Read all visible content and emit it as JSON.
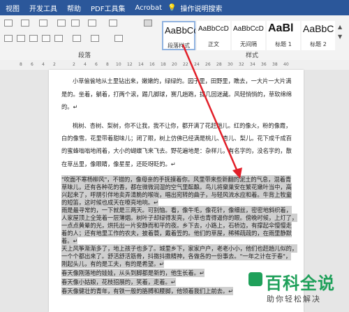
{
  "menu": {
    "items": [
      "视图",
      "开发工具",
      "帮助",
      "PDF工具集",
      "Acrobat"
    ],
    "tell_me": "操作说明搜索"
  },
  "ribbon": {
    "group_paragraph": "段落",
    "group_styles": "样式",
    "styles": [
      {
        "preview": "AaBbCcI",
        "name": "段落样式"
      },
      {
        "preview": "AaBbCcDc",
        "name": "正文"
      },
      {
        "preview": "AaBbCcDc",
        "name": "无间隔"
      },
      {
        "preview": "AaBl",
        "name": "标题 1"
      },
      {
        "preview": "AaBbC",
        "name": "标题 2"
      }
    ]
  },
  "ruler": {
    "ticks": [
      "8",
      "6",
      "4",
      "2",
      "2",
      "4",
      "6",
      "8",
      "10",
      "12",
      "14",
      "16",
      "18",
      "20",
      "22",
      "24",
      "26",
      "28",
      "30",
      "32",
      "34",
      "36",
      "38",
      "40"
    ]
  },
  "doc": {
    "lines": [
      "小草偷偷地从土里钻出来，嫩嫩的，绿绿的。园子里，田野里，瞧去，一大片一大片满",
      "是的。坐着，躺着，打两个滚，踢几脚球，赛几趟跑，捉几回迷藏。风轻悄悄的，草软绵绵",
      "的。↵",
      "桃树、杏树、梨树，你不让我，我不让你，都开满了花赶趟儿。红的像火，粉的像霞，",
      "白的像雪。花里带着甜味儿；闭了眼，树上仿佛已经满是桃儿、杏儿、梨儿。花下成千成百",
      "的蜜蜂嗡嗡地闹着，大小的蝴蝶飞来飞去。野花遍地是：杂样儿，有名字的，没名字的，散",
      "在草丛里，像眼睛，像星星，还眨呀眨的。↵",
      "\"吹面不寒杨柳风\"，不错的，像母亲的手抚摸着你。风里带来些新翻的泥土的气息，混着青",
      "草味儿，还有各种花的香，都在微微润湿的空气里酝酿。鸟儿将窠巢安在繁花嫩叶当中，高",
      "兴起来了，呼朋引伴地卖弄清脆的喉咙，唱出宛转的曲子，与轻风流水应和着。牛背上牧童",
      "的短笛，这时候也成天在嘹亮地响。↵",
      "雨是最寻常的，一下就是三两天。可别恼。看，像牛毛，像花针，像细丝，密密地斜织着，",
      "人家屋顶上全笼着一层薄烟。树叶子却绿得发亮，小草也青得逼你的眼。傍晚时候，上灯了，",
      "一点点黄晕的光，烘托出一片安静而和平的夜。乡下去，小路上，石桥边，有撑起伞慢慢走",
      "着的人；还有地里工作的农夫，披着蓑，戴着笠的。他们的草屋，稀稀疏疏的，在雨里静默",
      "着。↵",
      "天上风筝渐渐多了，地上孩子也多了。城里乡下，家家户户，老老小小，他们也赶趟儿似的，",
      "一个个都出来了。舒活舒活筋骨，抖擞抖擞精神，各做各的一份事去。\"一年之计在于春\"，",
      "刚起头儿，有的是工夫，有的是希望。↵",
      "春天像刚落地的娃娃，从头到脚都是新的，他生长着。↵",
      "春天像小姑娘，花枝招展的，笑着，走着。↵",
      "春天像健壮的青年，有铁一般的胳膊和腰脚，他领着我们上前去。↵"
    ]
  },
  "watermark": {
    "title": "百科全说",
    "subtitle": "助你轻松解决"
  },
  "colors": {
    "menubar": "#2b579a",
    "selection": "#cfcfcf",
    "arrow": "#e2202a",
    "brand": "#1fa05a"
  }
}
